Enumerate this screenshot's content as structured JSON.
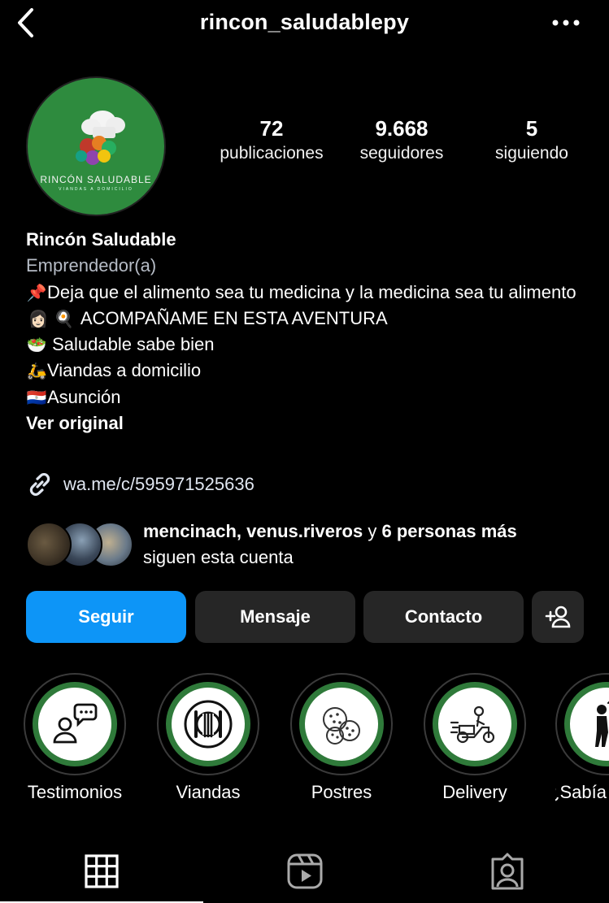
{
  "header": {
    "username": "rincon_saludablepy",
    "back_icon": "chevron-left-icon",
    "more_icon": "more-horizontal-icon"
  },
  "profile": {
    "avatar": {
      "brand_text": "RINCÓN SALUDABLE",
      "sub_text": "VIANDAS A DOMICILIO",
      "bg_color": "#2e8b3e"
    },
    "stats": [
      {
        "value": "72",
        "label": "publicaciones"
      },
      {
        "value": "9.668",
        "label": "seguidores"
      },
      {
        "value": "5",
        "label": "siguiendo"
      }
    ],
    "name": "Rincón Saludable",
    "category": "Emprendedor(a)",
    "bio_lines": [
      {
        "icon": "pushpin-icon",
        "emoji": "📌",
        "text": "Deja que el alimento sea tu medicina y la medicina sea tu alimento"
      },
      {
        "icon": "woman-cooking-icon",
        "emoji": "👩🏻 🍳",
        "text": " ACOMPAÑAME EN ESTA AVENTURA"
      },
      {
        "icon": "salad-icon",
        "emoji": "🥗",
        "text": " Saludable sabe bien"
      },
      {
        "icon": "scooter-icon",
        "emoji": "🛵",
        "text": "Viandas a domicilio"
      },
      {
        "icon": "paraguay-flag-icon",
        "emoji": "🇵🇾",
        "text": "Asunción"
      }
    ],
    "see_original": "Ver original",
    "link": {
      "icon": "link-icon",
      "url": "wa.me/c/595971525636"
    },
    "followed_by": {
      "names": "mencinach, venus.riveros",
      "connector": " y ",
      "others": "6 personas más",
      "suffix": "siguen esta cuenta"
    }
  },
  "actions": {
    "follow": "Seguir",
    "message": "Mensaje",
    "contact": "Contacto",
    "add_icon": "add-person-icon",
    "follow_color": "#0d95f7"
  },
  "highlights": [
    {
      "label": "Testimonios",
      "icon": "testimonial-person-icon"
    },
    {
      "label": "Viandas",
      "icon": "plate-cutlery-icon"
    },
    {
      "label": "Postres",
      "icon": "cookies-icon"
    },
    {
      "label": "Delivery",
      "icon": "delivery-scooter-icon"
    },
    {
      "label": "¿Sabía",
      "icon": "thinking-person-icon"
    }
  ],
  "highlight_ring_color": "#2f7a3a",
  "tabs": [
    {
      "name": "posts-grid",
      "icon": "grid-icon",
      "active": true
    },
    {
      "name": "reels",
      "icon": "reels-icon",
      "active": false
    },
    {
      "name": "tagged",
      "icon": "tagged-person-icon",
      "active": false
    }
  ]
}
